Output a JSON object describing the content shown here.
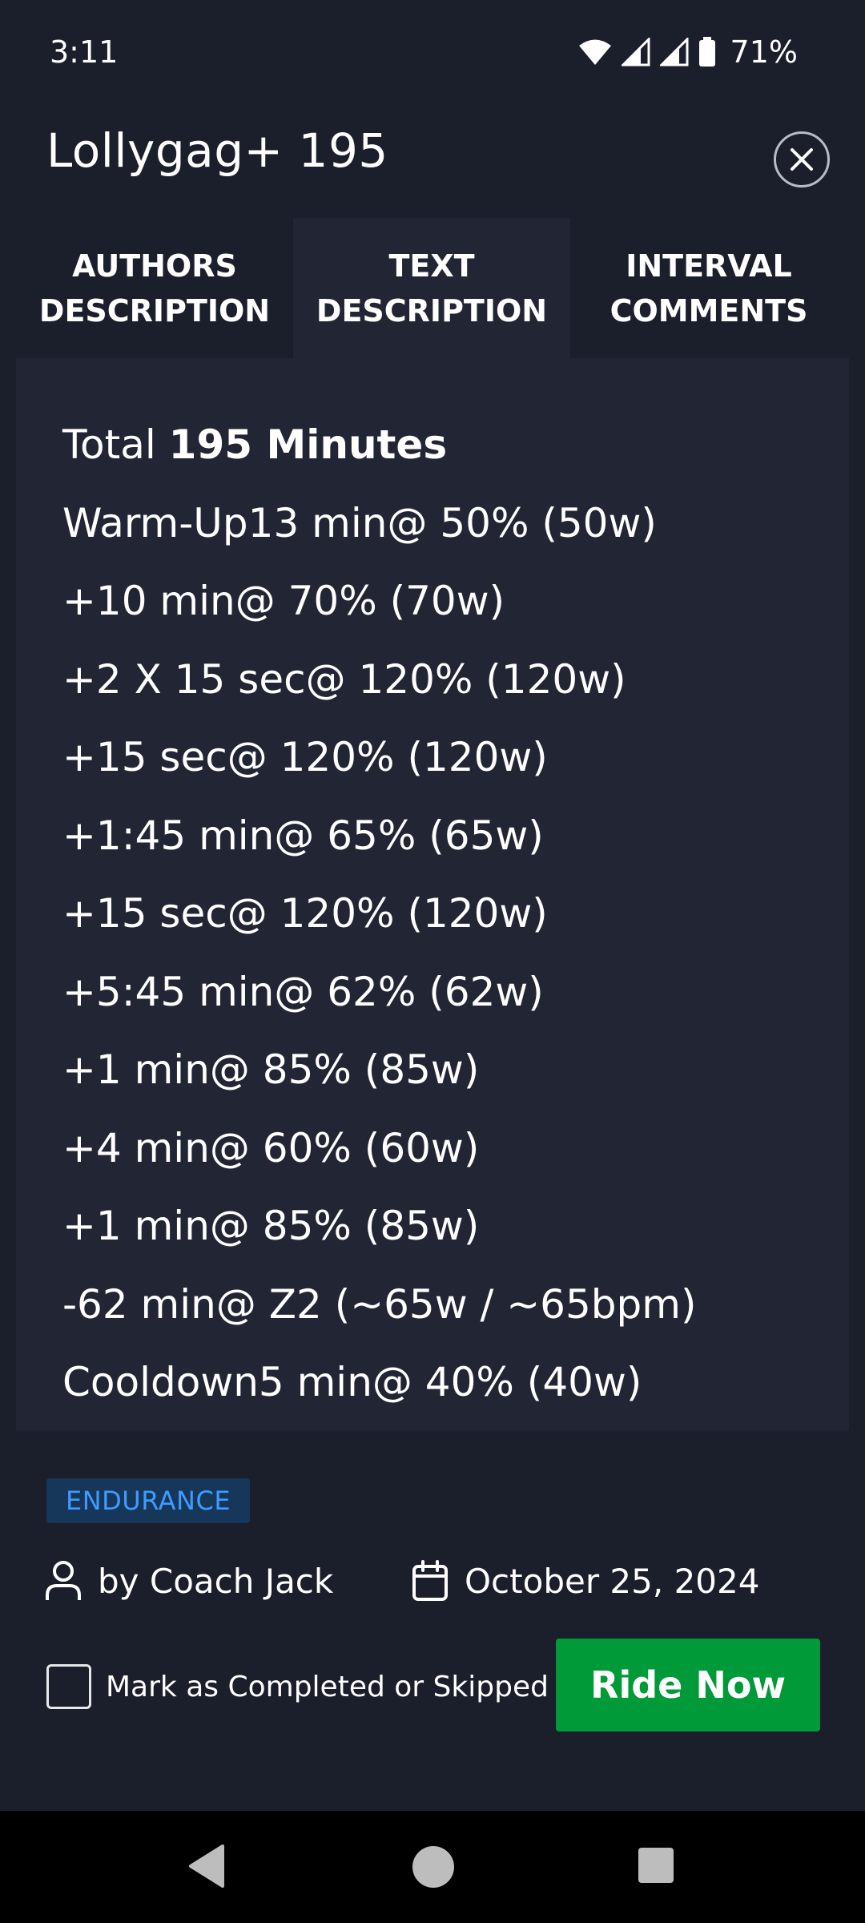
{
  "status_bar": {
    "time": "3:11",
    "battery": "71%"
  },
  "header": {
    "title": "Lollygag+ 195"
  },
  "tabs": [
    {
      "label": "AUTHORS\nDESCRIPTION"
    },
    {
      "label": "TEXT\nDESCRIPTION"
    },
    {
      "label": "INTERVAL\nCOMMENTS"
    }
  ],
  "description": {
    "total_prefix": "Total ",
    "total_value": "195 Minutes",
    "lines": [
      "Warm-Up13 min@ 50% (50w)",
      "+10 min@ 70% (70w)",
      "+2 X 15 sec@ 120% (120w)",
      "+15 sec@ 120% (120w)",
      "+1:45 min@ 65% (65w)",
      "+15 sec@ 120% (120w)",
      "+5:45 min@ 62% (62w)",
      "+1 min@ 85% (85w)",
      "+4 min@ 60% (60w)",
      "+1 min@ 85% (85w)",
      "-62 min@ Z2 (~65w / ~65bpm)",
      "Cooldown5 min@ 40% (40w)"
    ]
  },
  "workout": {
    "category": "ENDURANCE",
    "author": "by Coach Jack",
    "date": "October 25, 2024",
    "complete_label": "Mark as Completed or Skipped",
    "ride_button": "Ride Now"
  },
  "colors": {
    "background": "#1b1e2b",
    "panel": "#222534",
    "badge_bg": "#16365a",
    "badge_text": "#3f9bff",
    "ride_button": "#009a38"
  },
  "icons": {
    "close": "close-icon",
    "author": "person-icon",
    "date": "calendar-icon"
  }
}
